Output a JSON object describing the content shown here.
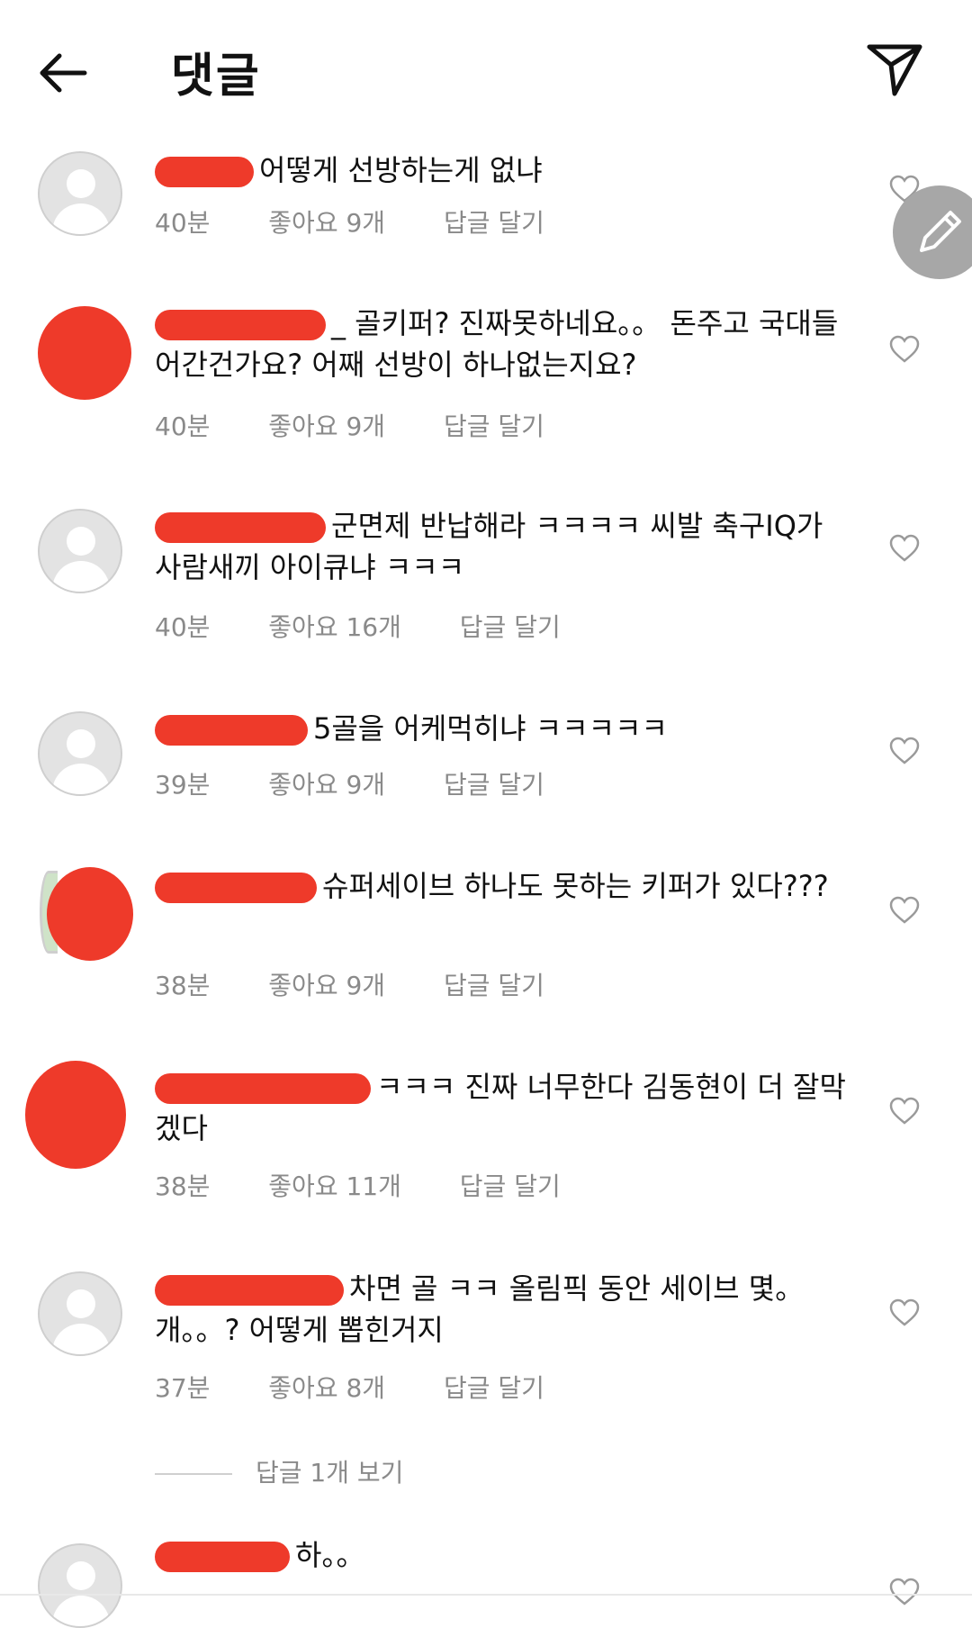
{
  "header": {
    "title": "댓글"
  },
  "comments": [
    {
      "text": "어떻게 선방하는게 없냐",
      "time": "40분",
      "likes": "좋아요 9개",
      "reply": "답글 달기",
      "avatar": "default-avatar"
    },
    {
      "text": "_ 골키퍼? 진짜못하네요。。 돈주고 국대들어간건가요? 어째 선방이 하나없는지요?",
      "time": "40분",
      "likes": "좋아요 9개",
      "reply": "답글 달기",
      "avatar": "redacted-avatar"
    },
    {
      "text": "군면제 반납해라 ㅋㅋㅋㅋ 씨발 축구IQ가 사람새끼 아이큐냐 ㅋㅋㅋ",
      "time": "40분",
      "likes": "좋아요 16개",
      "reply": "답글 달기",
      "avatar": "default-avatar"
    },
    {
      "text": "5골을 어케먹히냐 ㅋㅋㅋㅋㅋ",
      "time": "39분",
      "likes": "좋아요 9개",
      "reply": "답글 달기",
      "avatar": "default-avatar"
    },
    {
      "text": "슈퍼세이브 하나도 못하는 키퍼가 있다???",
      "time": "38분",
      "likes": "좋아요 9개",
      "reply": "답글 달기",
      "avatar": "redacted-avatar"
    },
    {
      "text": "ㅋㅋㅋ 진짜 너무한다 김동현이 더 잘막겠다",
      "time": "38분",
      "likes": "좋아요 11개",
      "reply": "답글 달기",
      "avatar": "redacted-avatar"
    },
    {
      "text": "차면 골 ㅋㅋ 올림픽 동안 세이브 몇。개。。? 어떻게 뽑힌거지",
      "time": "37분",
      "likes": "좋아요 8개",
      "reply": "답글 달기",
      "avatar": "default-avatar"
    },
    {
      "text": "하。。",
      "time": "",
      "likes": "",
      "reply": "",
      "avatar": "default-avatar"
    }
  ],
  "view_replies": "답글 1개 보기",
  "colors": {
    "redaction": "#ee3a2a",
    "meta_text": "#8a8a8a",
    "fab": "#a7a7a7"
  },
  "icons": [
    "back-arrow-icon",
    "send-icon",
    "heart-icon",
    "pencil-icon",
    "default-avatar-icon"
  ]
}
